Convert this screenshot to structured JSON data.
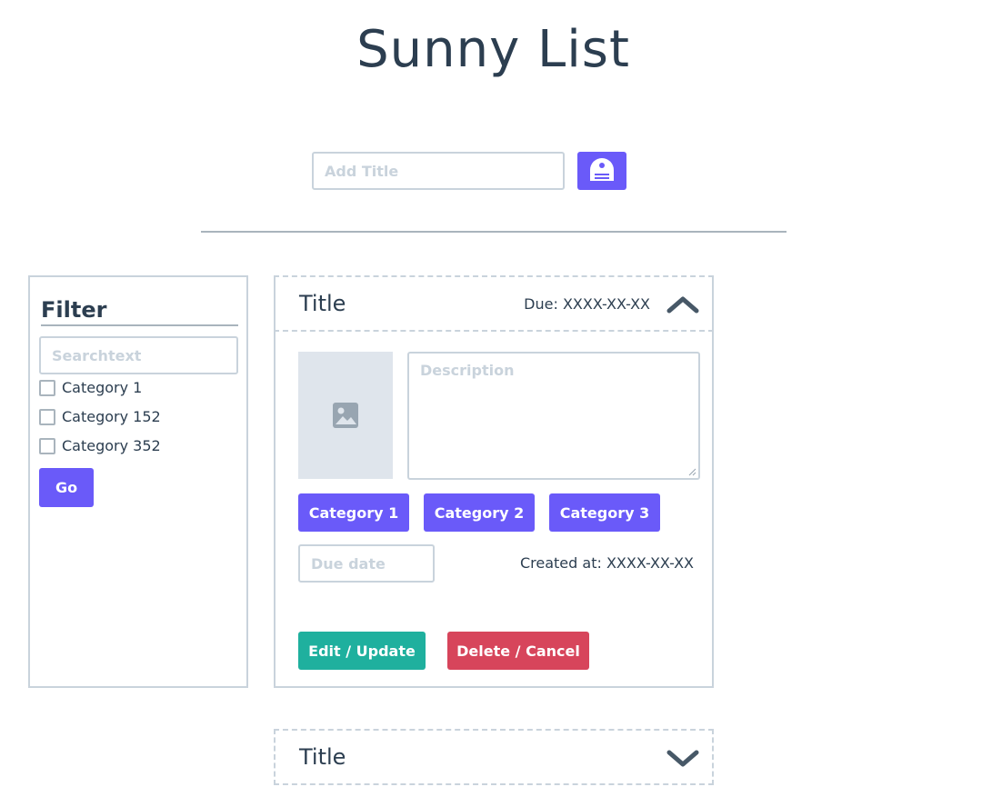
{
  "app": {
    "title": "Sunny List"
  },
  "add_form": {
    "title_placeholder": "Add Title",
    "button_icon": "save-disk-icon"
  },
  "filter": {
    "title": "Filter",
    "search_placeholder": "Searchtext",
    "categories": [
      "Category 1",
      "Category 152",
      "Category 352"
    ],
    "go_label": "Go"
  },
  "cards": [
    {
      "title": "Title",
      "due_text": "Due: XXXX-XX-XX",
      "expanded": true,
      "description_placeholder": "Description",
      "categories": [
        "Category 1",
        "Category 2",
        "Category 3"
      ],
      "due_date_placeholder": "Due date",
      "created_text": "Created at: XXXX-XX-XX",
      "edit_label": "Edit / Update",
      "delete_label": "Delete / Cancel"
    },
    {
      "title": "Title",
      "expanded": false
    }
  ],
  "colors": {
    "accent": "#6a5af9",
    "success": "#1fb09e",
    "danger": "#d7455b",
    "text": "#2c3e50",
    "border": "#c9d3dc"
  }
}
